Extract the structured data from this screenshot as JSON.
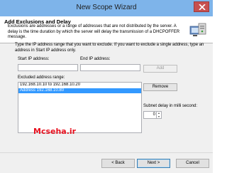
{
  "window": {
    "title": "New Scope Wizard"
  },
  "header": {
    "title": "Add Exclusions and Delay",
    "description": "Exclusions are addresses or a range of addresses that are not distributed by the server. A delay is the time duration by which the server will delay the transmission of a DHCPOFFER message."
  },
  "form": {
    "instruction": "Type the IP address range that you want to exclude. If you want to exclude a single address, type an address in Start IP address only.",
    "start_ip_label": "Start IP address:",
    "start_ip_value": "",
    "end_ip_label": "End IP address:",
    "end_ip_value": "",
    "add_label": "Add",
    "excluded_label": "Excluded address range:",
    "excluded_items": [
      "192.168.10.10 to 192.168.10.20",
      "Address 192.168.10.80"
    ],
    "selected_index": 1,
    "remove_label": "Remove",
    "delay_label": "Subnet delay in milli second:",
    "delay_value": "0"
  },
  "watermark": "Mcseha.ir",
  "footer": {
    "back_label": "< Back",
    "next_label": "Next >",
    "cancel_label": "Cancel"
  },
  "colors": {
    "titlebar": "#7eb4ea",
    "selection": "#3399ff",
    "watermark": "#e8101e",
    "close": "#c75050"
  }
}
